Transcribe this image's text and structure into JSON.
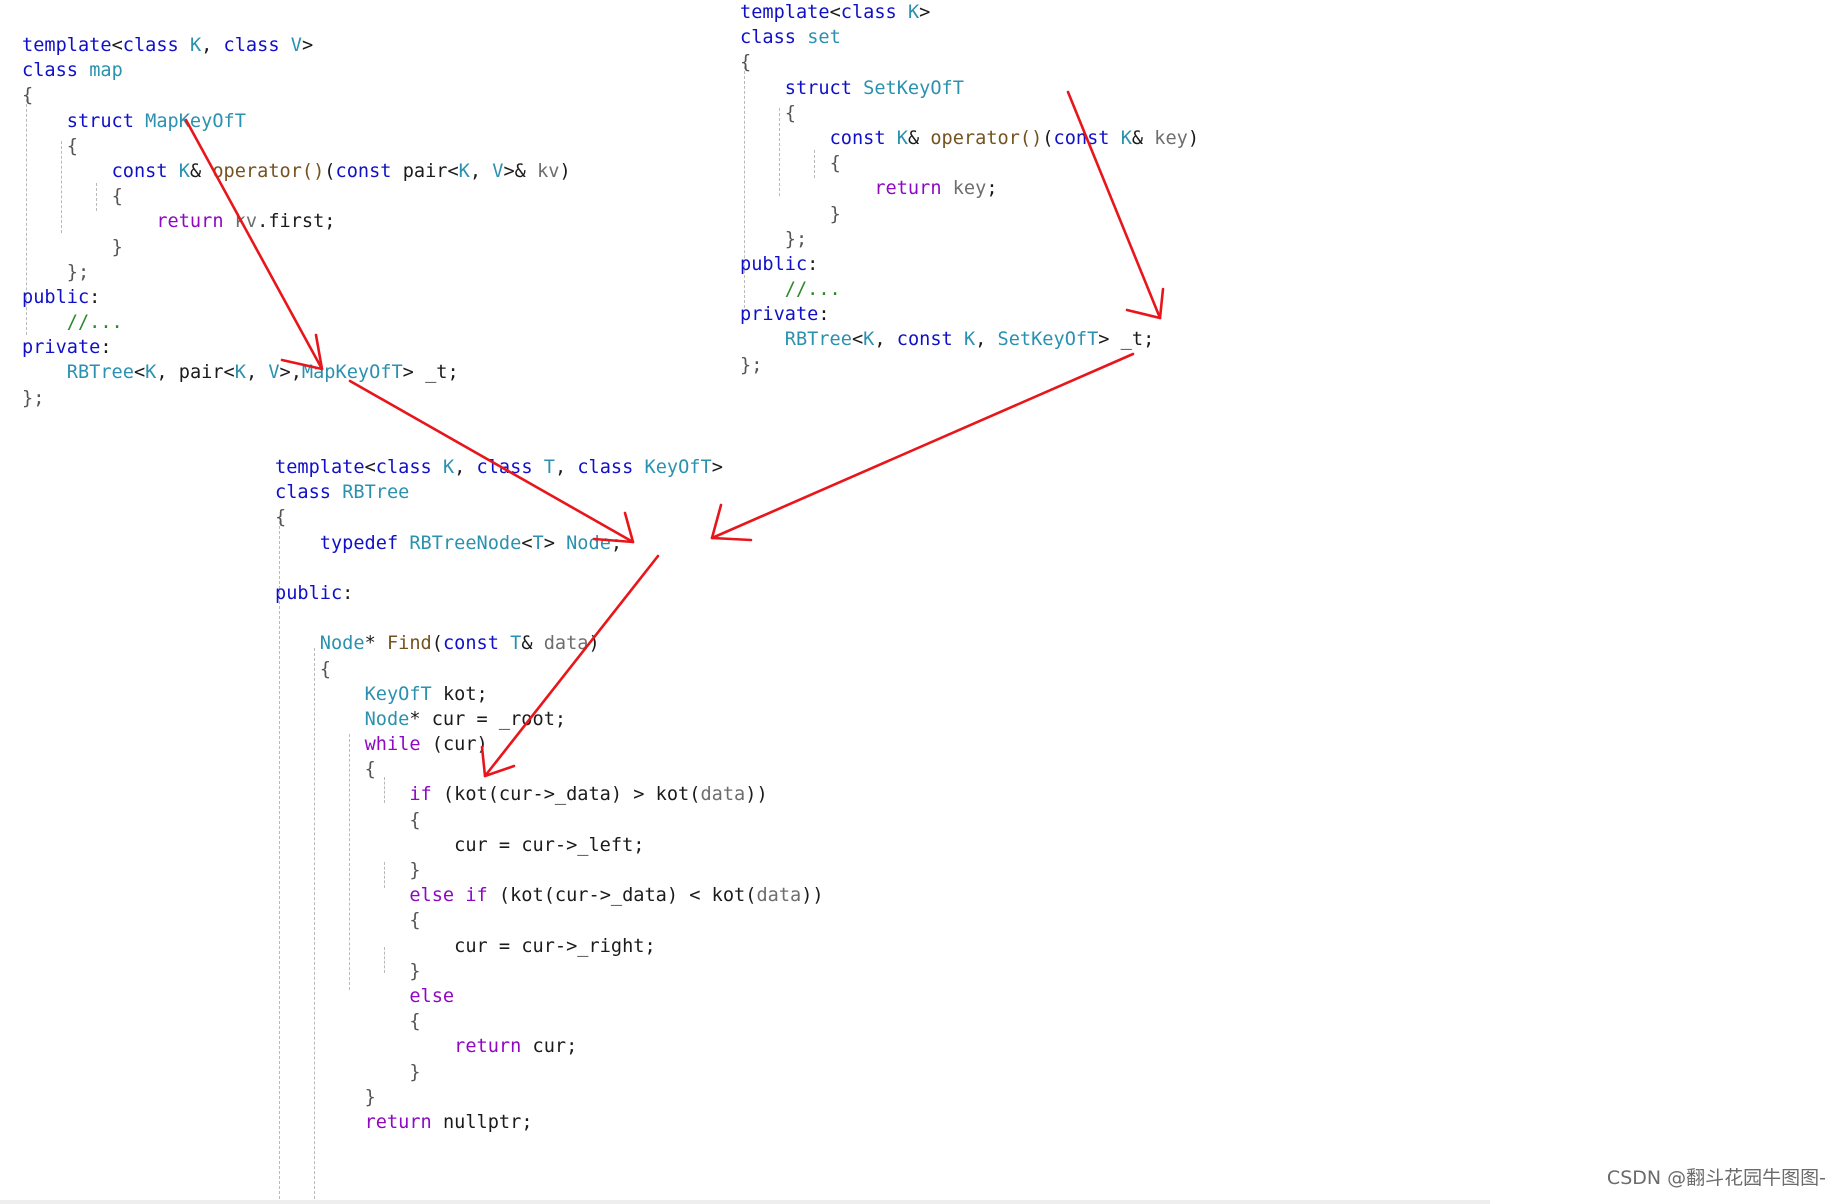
{
  "colors": {
    "keyword": "#1010c8",
    "type": "#2b91af",
    "function": "#74531f",
    "control": "#8f08c4",
    "comment": "#2a8a2a",
    "param": "#6e6e6e",
    "plain": "#1b1b1b",
    "arrow": "#e8161b"
  },
  "map_code": {
    "lines": [
      [
        [
          "kw",
          "template"
        ],
        [
          "op",
          "<"
        ],
        [
          "kw",
          "class"
        ],
        [
          "op",
          " "
        ],
        [
          "tp",
          "K"
        ],
        [
          "op",
          ", "
        ],
        [
          "kw",
          "class"
        ],
        [
          "op",
          " "
        ],
        [
          "tp",
          "V"
        ],
        [
          "op",
          ">"
        ]
      ],
      [
        [
          "kw",
          "class"
        ],
        [
          "op",
          " "
        ],
        [
          "ty",
          "map"
        ]
      ],
      [
        [
          "br",
          "{"
        ]
      ],
      [
        [
          "op",
          "    "
        ],
        [
          "kw",
          "struct"
        ],
        [
          "op",
          " "
        ],
        [
          "ty",
          "MapKeyOfT"
        ]
      ],
      [
        [
          "op",
          "    "
        ],
        [
          "br",
          "{"
        ]
      ],
      [
        [
          "op",
          "        "
        ],
        [
          "kw",
          "const"
        ],
        [
          "op",
          " "
        ],
        [
          "tp",
          "K"
        ],
        [
          "op",
          "& "
        ],
        [
          "fn",
          "operator()"
        ],
        [
          "op",
          "("
        ],
        [
          "kw",
          "const"
        ],
        [
          "op",
          " "
        ],
        [
          "id",
          "pair"
        ],
        [
          "op",
          "<"
        ],
        [
          "tp",
          "K"
        ],
        [
          "op",
          ", "
        ],
        [
          "tp",
          "V"
        ],
        [
          "op",
          ">& "
        ],
        [
          "pm",
          "kv"
        ],
        [
          "op",
          ")"
        ]
      ],
      [
        [
          "op",
          "        "
        ],
        [
          "br",
          "{"
        ]
      ],
      [
        [
          "op",
          "            "
        ],
        [
          "ctl",
          "return"
        ],
        [
          "op",
          " "
        ],
        [
          "pm",
          "kv"
        ],
        [
          "op",
          "."
        ],
        [
          "id",
          "first"
        ],
        [
          "op",
          ";"
        ]
      ],
      [
        [
          "op",
          "        "
        ],
        [
          "br",
          "}"
        ]
      ],
      [
        [
          "op",
          "    "
        ],
        [
          "br",
          "};"
        ]
      ],
      [
        [
          "kw",
          "public"
        ],
        [
          "op",
          ":"
        ]
      ],
      [
        [
          "op",
          "    "
        ],
        [
          "cm",
          "//..."
        ]
      ],
      [
        [
          "kw",
          "private"
        ],
        [
          "op",
          ":"
        ]
      ],
      [
        [
          "op",
          "    "
        ],
        [
          "ty",
          "RBTree"
        ],
        [
          "op",
          "<"
        ],
        [
          "tp",
          "K"
        ],
        [
          "op",
          ", "
        ],
        [
          "id",
          "pair"
        ],
        [
          "op",
          "<"
        ],
        [
          "tp",
          "K"
        ],
        [
          "op",
          ", "
        ],
        [
          "tp",
          "V"
        ],
        [
          "op",
          ">,"
        ],
        [
          "ty",
          "MapKeyOfT"
        ],
        [
          "op",
          "> "
        ],
        [
          "id",
          "_t"
        ],
        [
          "op",
          ";"
        ]
      ],
      [
        [
          "br",
          "};"
        ]
      ]
    ]
  },
  "set_code": {
    "lines": [
      [
        [
          "kw",
          "template"
        ],
        [
          "op",
          "<"
        ],
        [
          "kw",
          "class"
        ],
        [
          "op",
          " "
        ],
        [
          "tp",
          "K"
        ],
        [
          "op",
          ">"
        ]
      ],
      [
        [
          "kw",
          "class"
        ],
        [
          "op",
          " "
        ],
        [
          "ty",
          "set"
        ]
      ],
      [
        [
          "br",
          "{"
        ]
      ],
      [
        [
          "op",
          "    "
        ],
        [
          "kw",
          "struct"
        ],
        [
          "op",
          " "
        ],
        [
          "ty",
          "SetKeyOfT"
        ]
      ],
      [
        [
          "op",
          "    "
        ],
        [
          "br",
          "{"
        ]
      ],
      [
        [
          "op",
          "        "
        ],
        [
          "kw",
          "const"
        ],
        [
          "op",
          " "
        ],
        [
          "tp",
          "K"
        ],
        [
          "op",
          "& "
        ],
        [
          "fn",
          "operator()"
        ],
        [
          "op",
          "("
        ],
        [
          "kw",
          "const"
        ],
        [
          "op",
          " "
        ],
        [
          "tp",
          "K"
        ],
        [
          "op",
          "& "
        ],
        [
          "pm",
          "key"
        ],
        [
          "op",
          ")"
        ]
      ],
      [
        [
          "op",
          "        "
        ],
        [
          "br",
          "{"
        ]
      ],
      [
        [
          "op",
          "            "
        ],
        [
          "ctl",
          "return"
        ],
        [
          "op",
          " "
        ],
        [
          "pm",
          "key"
        ],
        [
          "op",
          ";"
        ]
      ],
      [
        [
          "op",
          "        "
        ],
        [
          "br",
          "}"
        ]
      ],
      [
        [
          "op",
          "    "
        ],
        [
          "br",
          "};"
        ]
      ],
      [
        [
          "kw",
          "public"
        ],
        [
          "op",
          ":"
        ]
      ],
      [
        [
          "op",
          "    "
        ],
        [
          "cm",
          "//..."
        ]
      ],
      [
        [
          "kw",
          "private"
        ],
        [
          "op",
          ":"
        ]
      ],
      [
        [
          "op",
          "    "
        ],
        [
          "ty",
          "RBTree"
        ],
        [
          "op",
          "<"
        ],
        [
          "tp",
          "K"
        ],
        [
          "op",
          ", "
        ],
        [
          "kw",
          "const"
        ],
        [
          "op",
          " "
        ],
        [
          "tp",
          "K"
        ],
        [
          "op",
          ", "
        ],
        [
          "ty",
          "SetKeyOfT"
        ],
        [
          "op",
          "> "
        ],
        [
          "id",
          "_t"
        ],
        [
          "op",
          ";"
        ]
      ],
      [
        [
          "br",
          "};"
        ]
      ]
    ]
  },
  "rbtree_code": {
    "lines": [
      [
        [
          "kw",
          "template"
        ],
        [
          "op",
          "<"
        ],
        [
          "kw",
          "class"
        ],
        [
          "op",
          " "
        ],
        [
          "tp",
          "K"
        ],
        [
          "op",
          ", "
        ],
        [
          "kw",
          "class"
        ],
        [
          "op",
          " "
        ],
        [
          "tp",
          "T"
        ],
        [
          "op",
          ", "
        ],
        [
          "kw",
          "class"
        ],
        [
          "op",
          " "
        ],
        [
          "tp",
          "KeyOfT"
        ],
        [
          "op",
          ">"
        ]
      ],
      [
        [
          "kw",
          "class"
        ],
        [
          "op",
          " "
        ],
        [
          "ty",
          "RBTree"
        ]
      ],
      [
        [
          "br",
          "{"
        ]
      ],
      [
        [
          "op",
          "    "
        ],
        [
          "kw",
          "typedef"
        ],
        [
          "op",
          " "
        ],
        [
          "ty",
          "RBTreeNode"
        ],
        [
          "op",
          "<"
        ],
        [
          "tp",
          "T"
        ],
        [
          "op",
          "> "
        ],
        [
          "ty",
          "Node"
        ],
        [
          "op",
          ";"
        ]
      ],
      [],
      [
        [
          "kw",
          "public"
        ],
        [
          "op",
          ":"
        ]
      ],
      [],
      [
        [
          "op",
          "    "
        ],
        [
          "ty",
          "Node"
        ],
        [
          "op",
          "* "
        ],
        [
          "fn",
          "Find"
        ],
        [
          "op",
          "("
        ],
        [
          "kw",
          "const"
        ],
        [
          "op",
          " "
        ],
        [
          "tp",
          "T"
        ],
        [
          "op",
          "& "
        ],
        [
          "pm",
          "data"
        ],
        [
          "op",
          ")"
        ]
      ],
      [
        [
          "op",
          "    "
        ],
        [
          "br",
          "{"
        ]
      ],
      [
        [
          "op",
          "        "
        ],
        [
          "tp",
          "KeyOfT"
        ],
        [
          "op",
          " "
        ],
        [
          "id",
          "kot"
        ],
        [
          "op",
          ";"
        ]
      ],
      [
        [
          "op",
          "        "
        ],
        [
          "ty",
          "Node"
        ],
        [
          "op",
          "* "
        ],
        [
          "id",
          "cur"
        ],
        [
          "op",
          " = "
        ],
        [
          "id",
          "_root"
        ],
        [
          "op",
          ";"
        ]
      ],
      [
        [
          "op",
          "        "
        ],
        [
          "ctl",
          "while"
        ],
        [
          "op",
          " ("
        ],
        [
          "id",
          "cur"
        ],
        [
          "op",
          ")"
        ]
      ],
      [
        [
          "op",
          "        "
        ],
        [
          "br",
          "{"
        ]
      ],
      [
        [
          "op",
          "            "
        ],
        [
          "ctl",
          "if"
        ],
        [
          "op",
          " ("
        ],
        [
          "id",
          "kot"
        ],
        [
          "op",
          "("
        ],
        [
          "id",
          "cur"
        ],
        [
          "op",
          "->"
        ],
        [
          "id",
          "_data"
        ],
        [
          "op",
          ") > "
        ],
        [
          "id",
          "kot"
        ],
        [
          "op",
          "("
        ],
        [
          "pm",
          "data"
        ],
        [
          "op",
          "))"
        ]
      ],
      [
        [
          "op",
          "            "
        ],
        [
          "br",
          "{"
        ]
      ],
      [
        [
          "op",
          "                "
        ],
        [
          "id",
          "cur"
        ],
        [
          "op",
          " = "
        ],
        [
          "id",
          "cur"
        ],
        [
          "op",
          "->"
        ],
        [
          "id",
          "_left"
        ],
        [
          "op",
          ";"
        ]
      ],
      [
        [
          "op",
          "            "
        ],
        [
          "br",
          "}"
        ]
      ],
      [
        [
          "op",
          "            "
        ],
        [
          "ctl",
          "else if"
        ],
        [
          "op",
          " ("
        ],
        [
          "id",
          "kot"
        ],
        [
          "op",
          "("
        ],
        [
          "id",
          "cur"
        ],
        [
          "op",
          "->"
        ],
        [
          "id",
          "_data"
        ],
        [
          "op",
          ") < "
        ],
        [
          "id",
          "kot"
        ],
        [
          "op",
          "("
        ],
        [
          "pm",
          "data"
        ],
        [
          "op",
          "))"
        ]
      ],
      [
        [
          "op",
          "            "
        ],
        [
          "br",
          "{"
        ]
      ],
      [
        [
          "op",
          "                "
        ],
        [
          "id",
          "cur"
        ],
        [
          "op",
          " = "
        ],
        [
          "id",
          "cur"
        ],
        [
          "op",
          "->"
        ],
        [
          "id",
          "_right"
        ],
        [
          "op",
          ";"
        ]
      ],
      [
        [
          "op",
          "            "
        ],
        [
          "br",
          "}"
        ]
      ],
      [
        [
          "op",
          "            "
        ],
        [
          "ctl",
          "else"
        ]
      ],
      [
        [
          "op",
          "            "
        ],
        [
          "br",
          "{"
        ]
      ],
      [
        [
          "op",
          "                "
        ],
        [
          "ctl",
          "return"
        ],
        [
          "op",
          " "
        ],
        [
          "id",
          "cur"
        ],
        [
          "op",
          ";"
        ]
      ],
      [
        [
          "op",
          "            "
        ],
        [
          "br",
          "}"
        ]
      ],
      [
        [
          "op",
          "        "
        ],
        [
          "br",
          "}"
        ]
      ],
      [
        [
          "op",
          "        "
        ],
        [
          "ctl",
          "return"
        ],
        [
          "op",
          " "
        ],
        [
          "id",
          "nullptr"
        ],
        [
          "op",
          ";"
        ]
      ]
    ]
  },
  "arrows": [
    {
      "name": "arrow-mapkeyoft-to-rbtree-arg"
    },
    {
      "name": "arrow-rbtree-arg-to-keyoft-param"
    },
    {
      "name": "arrow-setkeyoft-to-rbtree-arg"
    },
    {
      "name": "arrow-set-rbtree-arg-to-keyoft-param"
    },
    {
      "name": "arrow-keyoft-param-to-kot-variable"
    }
  ],
  "watermark": "CSDN @翻斗花园牛图图-"
}
